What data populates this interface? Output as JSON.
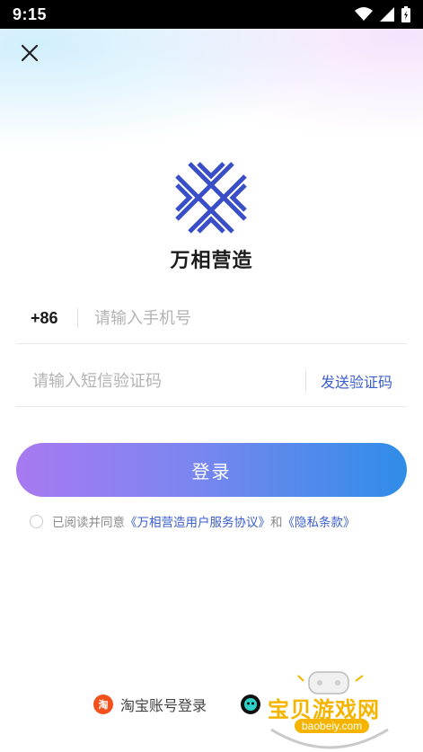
{
  "status_bar": {
    "time": "9:15"
  },
  "app": {
    "name": "万相营造"
  },
  "phone": {
    "country_code": "+86",
    "placeholder": "请输入手机号"
  },
  "verification": {
    "placeholder": "请输入短信验证码",
    "send_label": "发送验证码"
  },
  "login_button": {
    "label": "登录"
  },
  "agreement": {
    "prefix": "已阅读并同意",
    "user_agreement": "《万相营造用户服务协议》",
    "conjunction": "和",
    "privacy_policy": "《隐私条款》"
  },
  "alt_logins": {
    "taobao_icon_text": "淘",
    "taobao_label": "淘宝账号登录",
    "other_icon": "cartoon-face-icon"
  },
  "watermark": {
    "brand": "宝贝游戏网",
    "url": "baobeiy.com"
  },
  "colors": {
    "accent": "#3a5ccc",
    "gradient_start": "#a879f0",
    "gradient_end": "#2f8de8",
    "taobao": "#f2511b"
  }
}
